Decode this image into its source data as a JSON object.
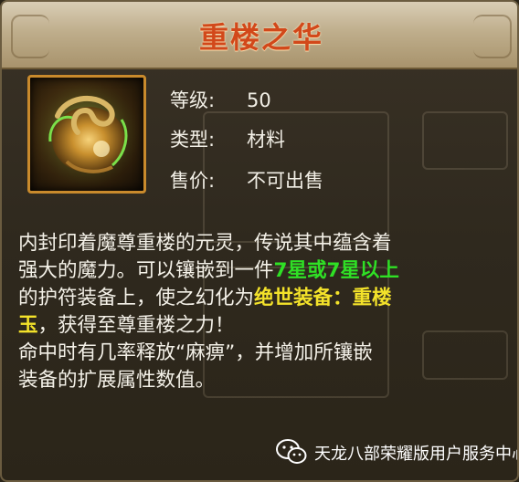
{
  "item": {
    "name": "重楼之华",
    "icon": "golden-jade-orb-icon"
  },
  "attributes": [
    {
      "key": "等级:",
      "value": "50"
    },
    {
      "key": "类型:",
      "value": "材料"
    },
    {
      "key": "售价:",
      "value": "不可出售"
    }
  ],
  "description": {
    "line1": "内封印着魔尊重楼的元灵，传说其中蕴含着",
    "line2_pre": "强大的魔力。可以镶嵌到一件",
    "line2_green": "7星或7星以上",
    "line3_pre": "的护符装备上，使之幻化为",
    "line3_yellow": "绝世装备：重楼",
    "line4_yellow": "玉",
    "line4_post": "，获得至尊重楼之力！",
    "line5": "命中时有几率释放“麻痹”，并增加所镶嵌",
    "line6": "装备的扩展属性数值。"
  },
  "footer": {
    "icon": "wechat-icon",
    "label": "天龙八部荣耀版用户服务中心"
  },
  "colors": {
    "title": "#d2481a",
    "highlight_green": "#2fe025",
    "highlight_yellow": "#f3e22a",
    "frame": "#c98a2c"
  }
}
